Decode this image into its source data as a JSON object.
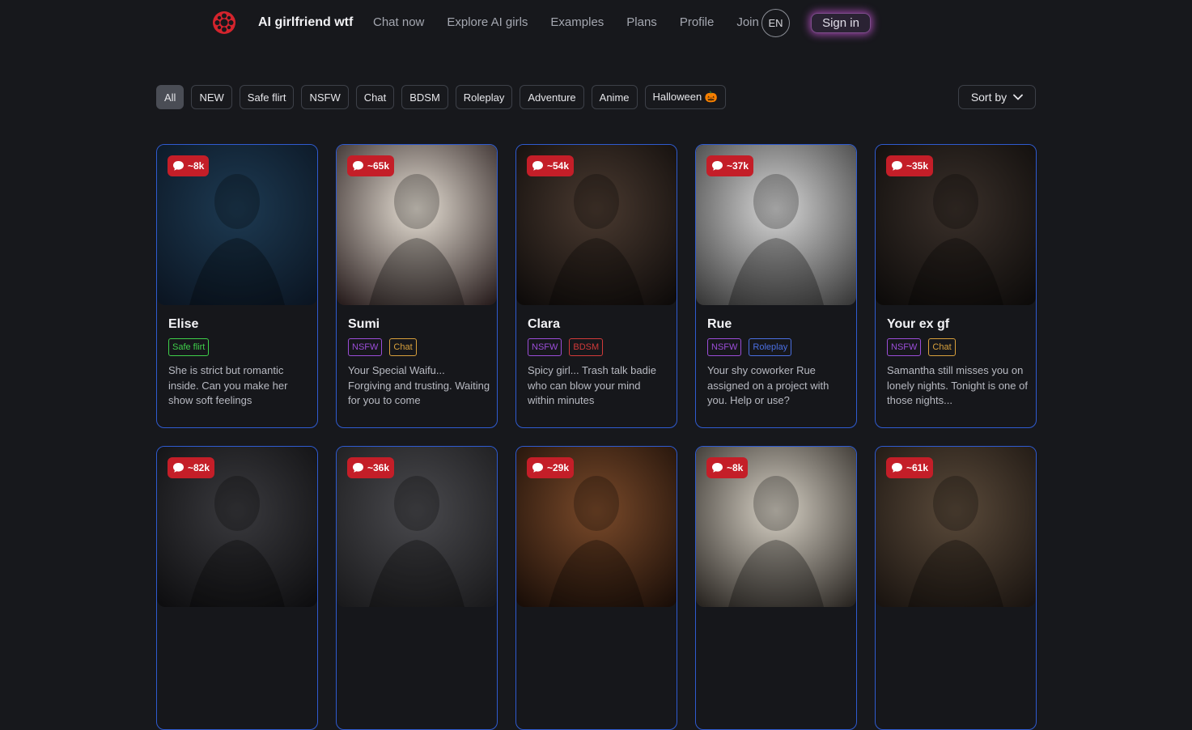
{
  "nav": {
    "brand": "AI girlfriend wtf",
    "links": [
      "Chat now",
      "Explore AI girls",
      "Examples",
      "Plans",
      "Profile",
      "Join"
    ],
    "lang": "EN",
    "signin": "Sign in"
  },
  "filters": {
    "chips": [
      "All",
      "NEW",
      "Safe flirt",
      "NSFW",
      "Chat",
      "BDSM",
      "Roleplay",
      "Adventure",
      "Anime",
      "Halloween 🎃"
    ],
    "active": "All",
    "sort_label": "Sort by"
  },
  "tag_colors": {
    "Safe flirt": "#3fcf4a",
    "NSFW": "#9b4dd8",
    "Chat": "#d9a03c",
    "BDSM": "#d23a3a",
    "Roleplay": "#4a6ee0"
  },
  "cards": [
    {
      "name": "Elise",
      "count": "~8k",
      "tags": [
        "Safe flirt"
      ],
      "desc": "She is strict but romantic inside. Can you make her show soft feelings",
      "bg": [
        "#1d3a52",
        "#0b1522"
      ]
    },
    {
      "name": "Sumi",
      "count": "~65k",
      "tags": [
        "NSFW",
        "Chat"
      ],
      "desc": "Your Special Waifu... Forgiving and trusting. Waiting for you to come",
      "bg": [
        "#e8e1d6",
        "#2a1f1f"
      ]
    },
    {
      "name": "Clara",
      "count": "~54k",
      "tags": [
        "NSFW",
        "BDSM"
      ],
      "desc": "Spicy girl... Trash talk badie who can blow your mind within minutes",
      "bg": [
        "#4a3a30",
        "#0e0b0a"
      ]
    },
    {
      "name": "Rue",
      "count": "~37k",
      "tags": [
        "NSFW",
        "Roleplay"
      ],
      "desc": "Your shy coworker Rue assigned on a project with you. Help or use?",
      "bg": [
        "#d8d8d8",
        "#3a3a3a"
      ]
    },
    {
      "name": "Your ex gf",
      "count": "~35k",
      "tags": [
        "NSFW",
        "Chat"
      ],
      "desc": "Samantha still misses you on lonely nights. Tonight is one of those nights...",
      "bg": [
        "#3a302a",
        "#0d0b0a"
      ]
    },
    {
      "name": "",
      "count": "~82k",
      "tags": [],
      "desc": "",
      "bg": [
        "#3a3a3e",
        "#0e0e10"
      ]
    },
    {
      "name": "",
      "count": "~36k",
      "tags": [],
      "desc": "",
      "bg": [
        "#4a4a4e",
        "#1a1a1c"
      ]
    },
    {
      "name": "",
      "count": "~29k",
      "tags": [],
      "desc": "",
      "bg": [
        "#7a4a2a",
        "#1a0e08"
      ]
    },
    {
      "name": "",
      "count": "~8k",
      "tags": [],
      "desc": "",
      "bg": [
        "#d8d2c6",
        "#2a2622"
      ]
    },
    {
      "name": "",
      "count": "~61k",
      "tags": [],
      "desc": "",
      "bg": [
        "#5a4a3a",
        "#1a1410"
      ]
    }
  ]
}
